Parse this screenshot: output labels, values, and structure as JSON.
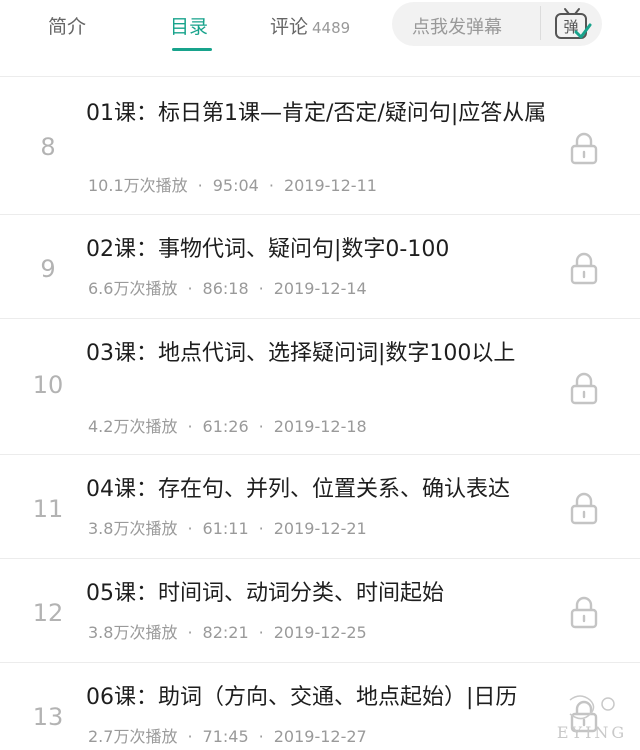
{
  "tabs": {
    "intro": "简介",
    "contents": "目录",
    "comments": "评论",
    "comment_count": "4489"
  },
  "danmaku": {
    "placeholder": "点我发弹幕",
    "icon_label": "弹"
  },
  "accent_color": "#18a38c",
  "lessons": [
    {
      "index": "8",
      "title": "01课：标日第1课—肯定/否定/疑问句|应答从属",
      "plays": "10.1万次播放",
      "duration": "95:04",
      "date": "2019-12-11"
    },
    {
      "index": "9",
      "title": "02课：事物代词、疑问句|数字0-100",
      "plays": "6.6万次播放",
      "duration": "86:18",
      "date": "2019-12-14"
    },
    {
      "index": "10",
      "title": "03课：地点代词、选择疑问词|数字100以上",
      "plays": "4.2万次播放",
      "duration": "61:26",
      "date": "2019-12-18"
    },
    {
      "index": "11",
      "title": "04课：存在句、并列、位置关系、确认表达",
      "plays": "3.8万次播放",
      "duration": "61:11",
      "date": "2019-12-21"
    },
    {
      "index": "12",
      "title": "05课：时间词、动词分类、时间起始",
      "plays": "3.8万次播放",
      "duration": "82:21",
      "date": "2019-12-25"
    },
    {
      "index": "13",
      "title": "06课：助词（方向、交通、地点起始）|日历",
      "plays": "2.7万次播放",
      "duration": "71:45",
      "date": "2019-12-27"
    }
  ],
  "watermark_text": "EYING"
}
